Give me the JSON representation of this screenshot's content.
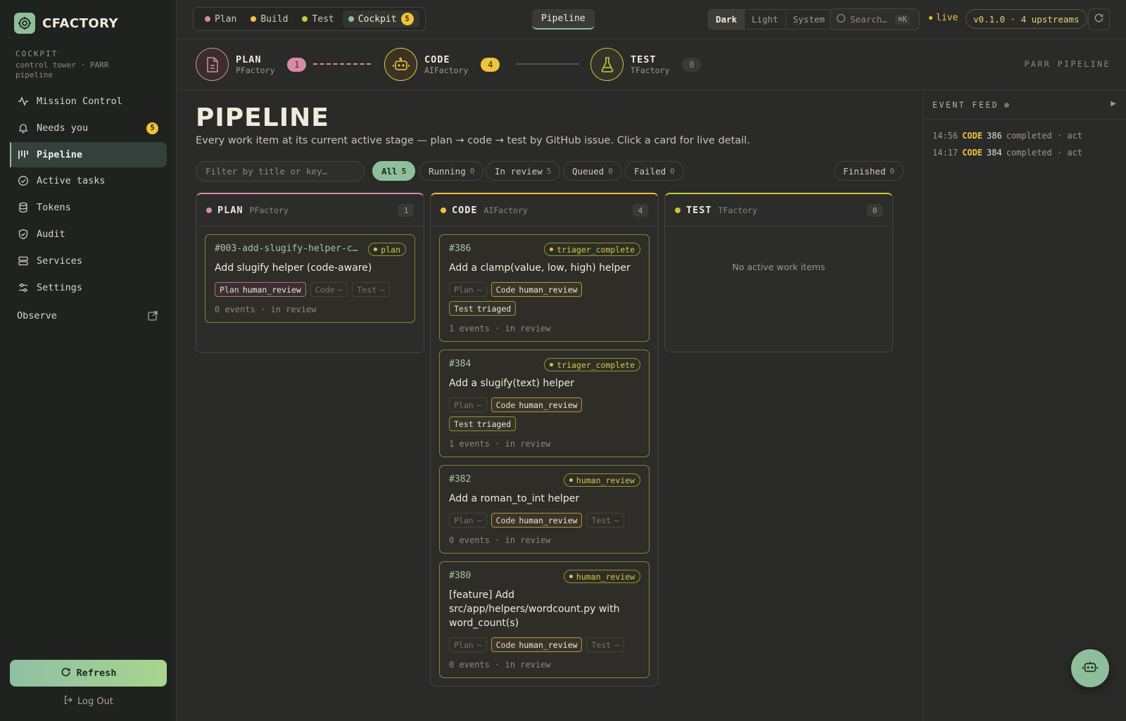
{
  "brand": {
    "name": "CFACTORY"
  },
  "sidebar": {
    "section_title": "COCKPIT",
    "section_sub": "control tower · PARR pipeline",
    "items": [
      {
        "label": "Mission Control",
        "icon": "activity-icon"
      },
      {
        "label": "Needs you",
        "icon": "bell-icon",
        "badge": "5"
      },
      {
        "label": "Pipeline",
        "icon": "kanban-icon",
        "active": true
      },
      {
        "label": "Active tasks",
        "icon": "check-circle-icon"
      },
      {
        "label": "Tokens",
        "icon": "database-icon"
      },
      {
        "label": "Audit",
        "icon": "shield-icon"
      },
      {
        "label": "Services",
        "icon": "server-icon"
      },
      {
        "label": "Settings",
        "icon": "sliders-icon"
      }
    ],
    "observe_label": "Observe",
    "refresh_label": "Refresh",
    "logout_label": "Log Out"
  },
  "topbar": {
    "tabs": [
      {
        "label": "Plan",
        "color": "#d98aa8"
      },
      {
        "label": "Build",
        "color": "#f0c33c"
      },
      {
        "label": "Test",
        "color": "#c9c83a"
      },
      {
        "label": "Cockpit",
        "color": "#8fbf9a",
        "count": "5"
      }
    ],
    "pipeline_label": "Pipeline",
    "theme_options": [
      "Dark",
      "Light",
      "System"
    ],
    "search_placeholder": "Search…",
    "search_shortcut": "⌘K",
    "live_label": "live",
    "version_label": "v0.1.0 · 4 upstreams"
  },
  "stages": [
    {
      "name": "PLAN",
      "factory": "PFactory",
      "count": "1",
      "color": "#d98aa8"
    },
    {
      "name": "CODE",
      "factory": "AIFactory",
      "count": "4",
      "color": "#f0c33c"
    },
    {
      "name": "TEST",
      "factory": "TFactory",
      "count": "0",
      "color": "#c9c83a"
    }
  ],
  "stage_band_label": "PARR PIPELINE",
  "main": {
    "title": "PIPELINE",
    "subtitle": "Every work item at its current active stage — plan → code → test by GitHub issue. Click a card for live detail.",
    "filter_placeholder": "Filter by title or key…",
    "chips": [
      {
        "label": "All",
        "count": "5",
        "active": true
      },
      {
        "label": "Running",
        "count": "0"
      },
      {
        "label": "In review",
        "count": "5"
      },
      {
        "label": "Queued",
        "count": "0"
      },
      {
        "label": "Failed",
        "count": "0"
      }
    ],
    "finished_chip": {
      "label": "Finished",
      "count": "0"
    }
  },
  "columns": [
    {
      "name": "PLAN",
      "factory": "PFactory",
      "count": "1",
      "color": "#d98aa8",
      "cards": [
        {
          "key": "#003-add-slugify-helper-c…",
          "tag": "plan",
          "title": "Add slugify helper (code-aware)",
          "stages": [
            {
              "name": "Plan",
              "value": "human_review",
              "on": "plan-on"
            },
            {
              "name": "Code",
              "value": "–",
              "on": ""
            },
            {
              "name": "Test",
              "value": "–",
              "on": ""
            }
          ],
          "meta": "0 events · in review"
        }
      ]
    },
    {
      "name": "CODE",
      "factory": "AIFactory",
      "count": "4",
      "color": "#f0c33c",
      "cards": [
        {
          "key": "#386",
          "tag": "triager_complete",
          "title": "Add a clamp(value, low, high) helper",
          "stages": [
            {
              "name": "Plan",
              "value": "–",
              "on": ""
            },
            {
              "name": "Code",
              "value": "human_review",
              "on": "code-on"
            },
            {
              "name": "Test",
              "value": "triaged",
              "on": "test-on"
            }
          ],
          "meta": "1 events · in review"
        },
        {
          "key": "#384",
          "tag": "triager_complete",
          "title": "Add a slugify(text) helper",
          "stages": [
            {
              "name": "Plan",
              "value": "–",
              "on": ""
            },
            {
              "name": "Code",
              "value": "human_review",
              "on": "code-on"
            },
            {
              "name": "Test",
              "value": "triaged",
              "on": "test-on"
            }
          ],
          "meta": "1 events · in review"
        },
        {
          "key": "#382",
          "tag": "human_review",
          "title": "Add a roman_to_int helper",
          "stages": [
            {
              "name": "Plan",
              "value": "–",
              "on": ""
            },
            {
              "name": "Code",
              "value": "human_review",
              "on": "code-on"
            },
            {
              "name": "Test",
              "value": "–",
              "on": ""
            }
          ],
          "meta": "0 events · in review"
        },
        {
          "key": "#380",
          "tag": "human_review",
          "title": "[feature] Add src/app/helpers/wordcount.py with word_count(s)",
          "stages": [
            {
              "name": "Plan",
              "value": "–",
              "on": ""
            },
            {
              "name": "Code",
              "value": "human_review",
              "on": "code-on"
            },
            {
              "name": "Test",
              "value": "–",
              "on": ""
            }
          ],
          "meta": "0 events · in review"
        }
      ]
    },
    {
      "name": "TEST",
      "factory": "TFactory",
      "count": "0",
      "color": "#c9c83a",
      "cards": [],
      "empty": "No active work items"
    }
  ],
  "feed": {
    "title": "EVENT FEED",
    "events": [
      {
        "time": "14:56",
        "kind": "CODE",
        "num": "386",
        "text": "completed · act"
      },
      {
        "time": "14:17",
        "kind": "CODE",
        "num": "384",
        "text": "completed · act"
      }
    ]
  }
}
